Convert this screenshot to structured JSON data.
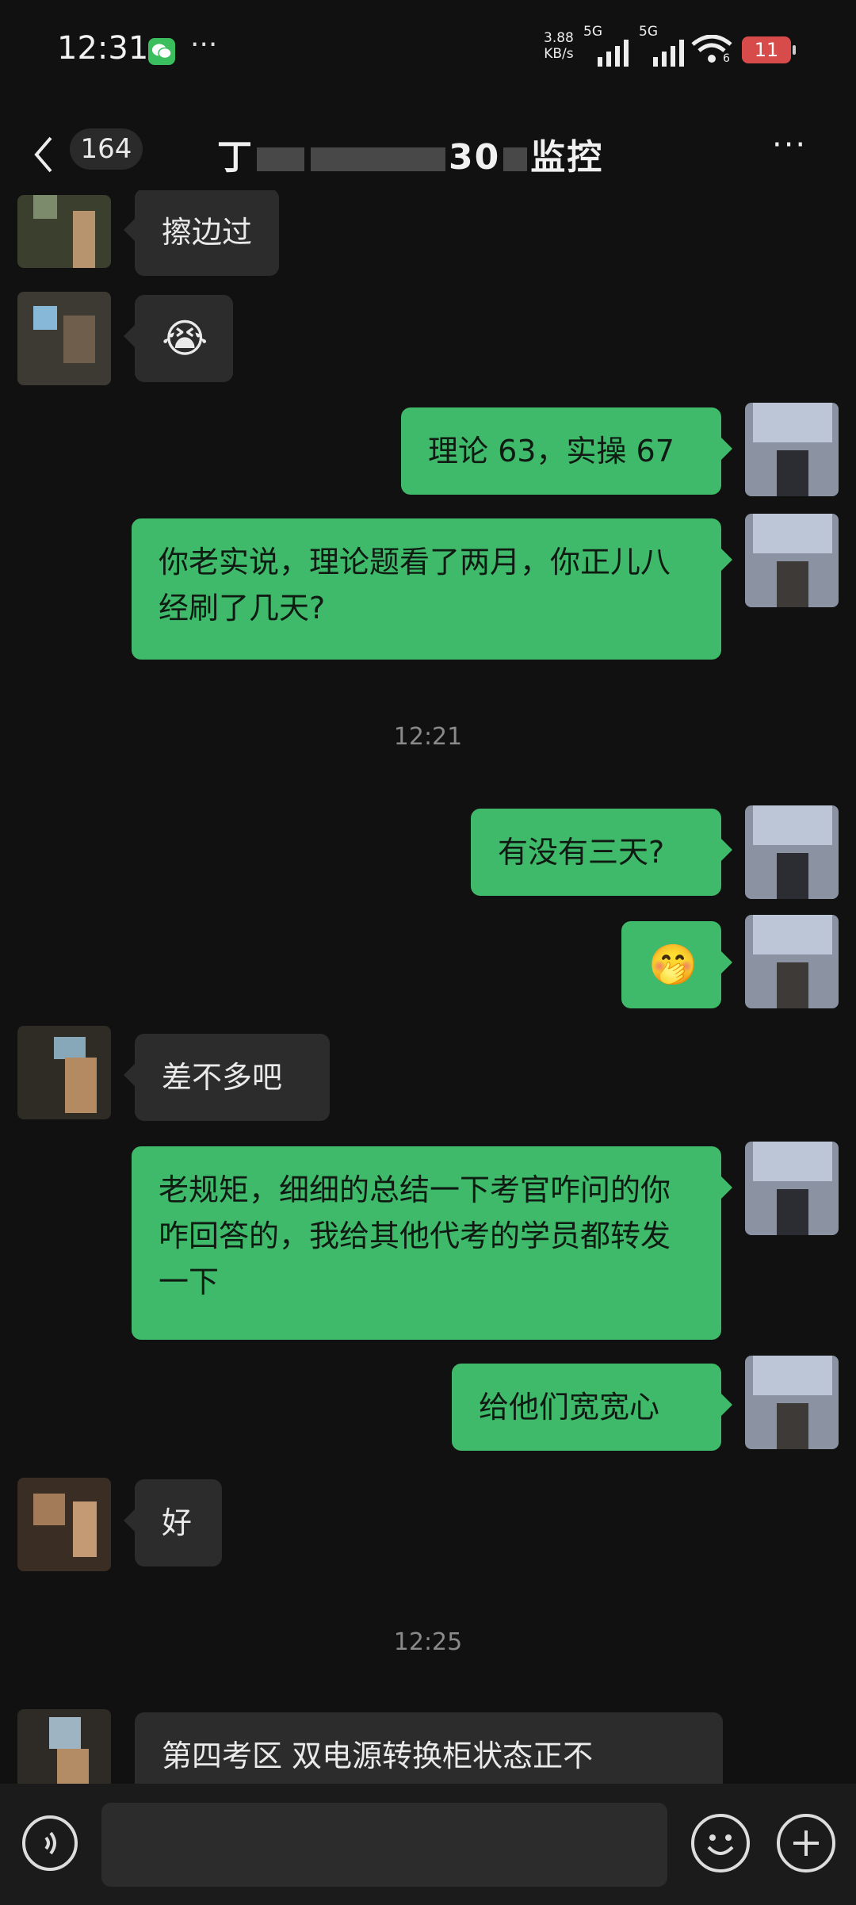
{
  "status_bar": {
    "time": "12:31",
    "dots": "···",
    "net_speed_value": "3.88",
    "net_speed_unit": "KB/s",
    "signal1_label": "5G",
    "signal2_label": "5G",
    "wifi_sub": "6",
    "battery": "11"
  },
  "header": {
    "unread_count": "164",
    "title_visible_start": "丁",
    "title_visible_end": "30",
    "title_tail": "监控",
    "more": "···"
  },
  "messages": [
    {
      "side": "in",
      "text": "擦边过"
    },
    {
      "side": "in",
      "emoji": "😭"
    },
    {
      "side": "out",
      "text": "理论 63，实操 67"
    },
    {
      "side": "out",
      "text": "你老实说，理论题看了两月，你正儿八经刷了几天?"
    },
    {
      "timestamp": "12:21"
    },
    {
      "side": "out",
      "text": "有没有三天?"
    },
    {
      "side": "out",
      "emoji": "🤭"
    },
    {
      "side": "in",
      "text": "差不多吧"
    },
    {
      "side": "out",
      "text": "老规矩，细细的总结一下考官咋问的你咋回答的，我给其他代考的学员都转发一下"
    },
    {
      "side": "out",
      "text": "给他们宽宽心"
    },
    {
      "side": "in",
      "text": "好"
    },
    {
      "timestamp": "12:25"
    },
    {
      "side": "in",
      "text": "第四考区 双电源转换柜状态正不"
    }
  ],
  "colors": {
    "background": "#111111",
    "bubble_out": "#3fba6a",
    "bubble_in": "#2c2c2c",
    "battery": "#d84b4b"
  },
  "icons": [
    "wechat-icon",
    "back-icon",
    "more-icon",
    "voice-icon",
    "emoji-icon",
    "plus-icon"
  ]
}
